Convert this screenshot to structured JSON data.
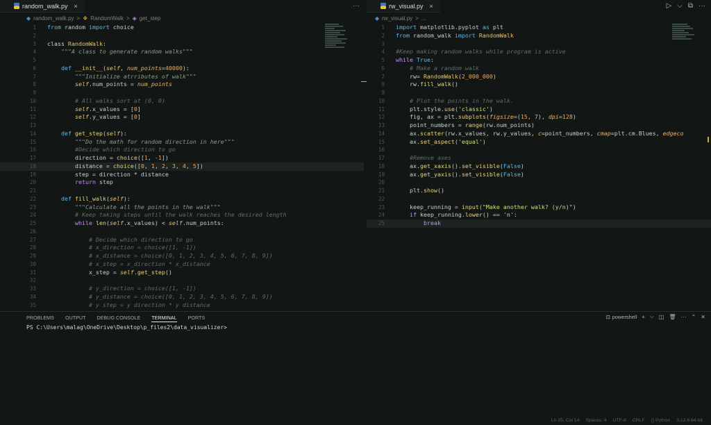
{
  "left_tab": {
    "name": "random_walk.py",
    "close": "×"
  },
  "right_tab": {
    "name": "rw_visual.py",
    "close": "×"
  },
  "more": "···",
  "run_actions": [
    "▷",
    "⌵",
    "⧉",
    "···"
  ],
  "left_breadcrumb": [
    "random_walk.py",
    ">",
    "RandomWalk",
    ">",
    "get_step"
  ],
  "right_breadcrumb": [
    "rw_visual.py",
    ">",
    "..."
  ],
  "panel": {
    "tabs": [
      "PROBLEMS",
      "OUTPUT",
      "DEBUG CONSOLE",
      "TERMINAL",
      "PORTS"
    ],
    "active_tab": "TERMINAL",
    "shell": "powershell",
    "actions": [
      "+",
      "⌵",
      "◫",
      "🗑",
      "···",
      "⌃",
      "✕"
    ],
    "terminal_text": "PS C:\\Users\\malag\\OneDrive\\Desktop\\p_files2\\data_visualizer>"
  },
  "status": [
    "Ln 25, Col 14",
    "Spaces: 4",
    "UTF-8",
    "CRLF",
    "{} Python",
    "3.12.6 64-bit"
  ],
  "left_code": [
    {
      "n": 1,
      "t": [
        [
          "kw2",
          "from"
        ],
        [
          "pun",
          " random "
        ],
        [
          "kw2",
          "import"
        ],
        [
          "pun",
          " choice"
        ]
      ]
    },
    {
      "n": 2,
      "t": []
    },
    {
      "n": 3,
      "t": [
        [
          "pun",
          "class "
        ],
        [
          "cls",
          "RandomWalk"
        ],
        [
          "pun",
          ":"
        ]
      ]
    },
    {
      "n": 4,
      "t": [
        [
          "pun",
          "    "
        ],
        [
          "doc",
          "\"\"\"A class to generate random walks\"\"\""
        ]
      ]
    },
    {
      "n": 5,
      "t": []
    },
    {
      "n": 6,
      "t": [
        [
          "pun",
          "    "
        ],
        [
          "kw2",
          "def"
        ],
        [
          "fn",
          " __init__"
        ],
        [
          "pun",
          "("
        ],
        [
          "selfc",
          "self"
        ],
        [
          "pun",
          ", "
        ],
        [
          "par",
          "num_points"
        ],
        [
          "pun",
          "="
        ],
        [
          "num",
          "40000"
        ],
        [
          "pun",
          "):"
        ]
      ]
    },
    {
      "n": 7,
      "t": [
        [
          "pun",
          "        "
        ],
        [
          "doc",
          "\"\"\"Initialize atrributes of walk\"\"\""
        ]
      ]
    },
    {
      "n": 8,
      "t": [
        [
          "pun",
          "        "
        ],
        [
          "selfc",
          "self"
        ],
        [
          "pun",
          ".num_points = "
        ],
        [
          "par",
          "num_points"
        ]
      ]
    },
    {
      "n": 9,
      "t": []
    },
    {
      "n": 10,
      "t": [
        [
          "pun",
          "        "
        ],
        [
          "cmt",
          "# All walks sort at (0, 0)"
        ]
      ]
    },
    {
      "n": 11,
      "t": [
        [
          "pun",
          "        "
        ],
        [
          "selfc",
          "self"
        ],
        [
          "pun",
          ".x_values = ["
        ],
        [
          "num",
          "0"
        ],
        [
          "pun",
          "]"
        ]
      ]
    },
    {
      "n": 12,
      "t": [
        [
          "pun",
          "        "
        ],
        [
          "selfc",
          "self"
        ],
        [
          "pun",
          ".y_values = ["
        ],
        [
          "num",
          "0"
        ],
        [
          "pun",
          "]"
        ]
      ]
    },
    {
      "n": 13,
      "t": []
    },
    {
      "n": 14,
      "t": [
        [
          "pun",
          "    "
        ],
        [
          "kw2",
          "def"
        ],
        [
          "fn",
          " get_step"
        ],
        [
          "pun",
          "("
        ],
        [
          "selfc",
          "self"
        ],
        [
          "pun",
          "):"
        ]
      ]
    },
    {
      "n": 15,
      "t": [
        [
          "pun",
          "        "
        ],
        [
          "doc",
          "\"\"\"Do the math for random direction in here\"\"\""
        ]
      ]
    },
    {
      "n": 16,
      "t": [
        [
          "pun",
          "        "
        ],
        [
          "cmt",
          "#Decide which direction to go"
        ]
      ]
    },
    {
      "n": 17,
      "t": [
        [
          "pun",
          "        direction = "
        ],
        [
          "fn",
          "choice"
        ],
        [
          "pun",
          "(["
        ],
        [
          "num",
          "1"
        ],
        [
          "pun",
          ", "
        ],
        [
          "num",
          "-1"
        ],
        [
          "pun",
          "])"
        ]
      ]
    },
    {
      "n": 18,
      "t": [
        [
          "pun",
          "        distance = "
        ],
        [
          "fn",
          "choice"
        ],
        [
          "pun",
          "(["
        ],
        [
          "num",
          "0"
        ],
        [
          "pun",
          ", "
        ],
        [
          "num",
          "1"
        ],
        [
          "pun",
          ", "
        ],
        [
          "num",
          "2"
        ],
        [
          "pun",
          ", "
        ],
        [
          "num",
          "3"
        ],
        [
          "pun",
          ", "
        ],
        [
          "num",
          "4"
        ],
        [
          "pun",
          ", "
        ],
        [
          "num",
          "5"
        ],
        [
          "pun",
          "])"
        ]
      ],
      "cur": true
    },
    {
      "n": 19,
      "t": [
        [
          "pun",
          "        step = direction * distance"
        ]
      ]
    },
    {
      "n": 20,
      "t": [
        [
          "pun",
          "        "
        ],
        [
          "kw",
          "return"
        ],
        [
          "pun",
          " step"
        ]
      ]
    },
    {
      "n": 21,
      "t": []
    },
    {
      "n": 22,
      "t": [
        [
          "pun",
          "    "
        ],
        [
          "kw2",
          "def"
        ],
        [
          "fn",
          " fill_walk"
        ],
        [
          "pun",
          "("
        ],
        [
          "selfc",
          "self"
        ],
        [
          "pun",
          "):"
        ]
      ]
    },
    {
      "n": 23,
      "t": [
        [
          "pun",
          "        "
        ],
        [
          "doc",
          "\"\"\"Calculate all the points in the walk\"\"\""
        ]
      ]
    },
    {
      "n": 24,
      "t": [
        [
          "pun",
          "        "
        ],
        [
          "cmt",
          "# Keep taking steps until the walk reaches the desired length"
        ]
      ]
    },
    {
      "n": 25,
      "t": [
        [
          "pun",
          "        "
        ],
        [
          "kw",
          "while"
        ],
        [
          "pun",
          " "
        ],
        [
          "fn",
          "len"
        ],
        [
          "pun",
          "("
        ],
        [
          "selfc",
          "self"
        ],
        [
          "pun",
          ".x_values) < "
        ],
        [
          "selfc",
          "self"
        ],
        [
          "pun",
          ".num_points:"
        ]
      ]
    },
    {
      "n": 26,
      "t": []
    },
    {
      "n": 27,
      "t": [
        [
          "pun",
          "            "
        ],
        [
          "cmt",
          "# Decide which direction to go"
        ]
      ]
    },
    {
      "n": 28,
      "t": [
        [
          "pun",
          "            "
        ],
        [
          "cmt",
          "# x_direction = choice([1, -1])"
        ]
      ]
    },
    {
      "n": 29,
      "t": [
        [
          "pun",
          "            "
        ],
        [
          "cmt",
          "# x_distance = choice([0, 1, 2, 3, 4, 5, 6, 7, 8, 9])"
        ]
      ]
    },
    {
      "n": 30,
      "t": [
        [
          "pun",
          "            "
        ],
        [
          "cmt",
          "# x_step = x_direction * x_distance"
        ]
      ]
    },
    {
      "n": 31,
      "t": [
        [
          "pun",
          "            x_step = "
        ],
        [
          "selfc",
          "self"
        ],
        [
          "pun",
          "."
        ],
        [
          "fn",
          "get_step"
        ],
        [
          "pun",
          "()"
        ]
      ]
    },
    {
      "n": 32,
      "t": []
    },
    {
      "n": 33,
      "t": [
        [
          "pun",
          "            "
        ],
        [
          "cmt",
          "# y_direction = choice([1, -1])"
        ]
      ]
    },
    {
      "n": 34,
      "t": [
        [
          "pun",
          "            "
        ],
        [
          "cmt",
          "# y_distance = choice([0, 1, 2, 3, 4, 5, 6, 7, 8, 9])"
        ]
      ]
    },
    {
      "n": 35,
      "t": [
        [
          "pun",
          "            "
        ],
        [
          "cmt",
          "# y step = y direction * y distance"
        ]
      ]
    }
  ],
  "right_code": [
    {
      "n": 1,
      "t": [
        [
          "kw2",
          "import"
        ],
        [
          "pun",
          " matplotlib.pyplot "
        ],
        [
          "kw2",
          "as"
        ],
        [
          "pun",
          " plt"
        ]
      ]
    },
    {
      "n": 2,
      "t": [
        [
          "kw2",
          "from"
        ],
        [
          "pun",
          " random_walk "
        ],
        [
          "kw2",
          "import"
        ],
        [
          "pun",
          " "
        ],
        [
          "cls",
          "RandomWalk"
        ]
      ]
    },
    {
      "n": 3,
      "t": []
    },
    {
      "n": 4,
      "t": [
        [
          "cmt",
          "#Keep making random walks while program is active"
        ]
      ]
    },
    {
      "n": 5,
      "t": [
        [
          "kw",
          "while"
        ],
        [
          "pun",
          " "
        ],
        [
          "kw2",
          "True"
        ],
        [
          "pun",
          ":"
        ]
      ]
    },
    {
      "n": 6,
      "t": [
        [
          "pun",
          "    "
        ],
        [
          "cmt",
          "# Make a random walk"
        ]
      ]
    },
    {
      "n": 7,
      "t": [
        [
          "pun",
          "    rw= "
        ],
        [
          "cls",
          "RandomWalk"
        ],
        [
          "pun",
          "("
        ],
        [
          "num",
          "2_000_000"
        ],
        [
          "pun",
          ")"
        ]
      ]
    },
    {
      "n": 8,
      "t": [
        [
          "pun",
          "    rw."
        ],
        [
          "fn",
          "fill_walk"
        ],
        [
          "pun",
          "()"
        ]
      ]
    },
    {
      "n": 9,
      "t": []
    },
    {
      "n": 10,
      "t": [
        [
          "pun",
          "    "
        ],
        [
          "cmt",
          "# Plot the points in the walk."
        ]
      ]
    },
    {
      "n": 11,
      "t": [
        [
          "pun",
          "    plt.style."
        ],
        [
          "fn",
          "use"
        ],
        [
          "pun",
          "("
        ],
        [
          "str",
          "'classic'"
        ],
        [
          "pun",
          ")"
        ]
      ]
    },
    {
      "n": 12,
      "t": [
        [
          "pun",
          "    fig, ax = plt."
        ],
        [
          "fn",
          "subplots"
        ],
        [
          "pun",
          "("
        ],
        [
          "par",
          "figsize"
        ],
        [
          "pun",
          "=("
        ],
        [
          "num",
          "15"
        ],
        [
          "pun",
          ", "
        ],
        [
          "num",
          "7"
        ],
        [
          "pun",
          "), "
        ],
        [
          "par",
          "dpi"
        ],
        [
          "pun",
          "="
        ],
        [
          "num",
          "128"
        ],
        [
          "pun",
          ")"
        ]
      ]
    },
    {
      "n": 13,
      "t": [
        [
          "pun",
          "    point_numbers = "
        ],
        [
          "fn",
          "range"
        ],
        [
          "pun",
          "(rw.num_points)"
        ]
      ]
    },
    {
      "n": 14,
      "t": [
        [
          "pun",
          "    ax."
        ],
        [
          "fn",
          "scatter"
        ],
        [
          "pun",
          "(rw.x_values, rw.y_values, "
        ],
        [
          "par",
          "c"
        ],
        [
          "pun",
          "=point_numbers, "
        ],
        [
          "par",
          "cmap"
        ],
        [
          "pun",
          "=plt.cm.Blues, "
        ],
        [
          "par",
          "edgeco"
        ]
      ]
    },
    {
      "n": 15,
      "t": [
        [
          "pun",
          "    ax."
        ],
        [
          "fn",
          "set_aspect"
        ],
        [
          "pun",
          "("
        ],
        [
          "str",
          "'equal'"
        ],
        [
          "pun",
          ")"
        ]
      ]
    },
    {
      "n": 16,
      "t": []
    },
    {
      "n": 17,
      "t": [
        [
          "pun",
          "    "
        ],
        [
          "cmt",
          "#Remove axes"
        ]
      ]
    },
    {
      "n": 18,
      "t": [
        [
          "pun",
          "    ax."
        ],
        [
          "fn",
          "get_xaxis"
        ],
        [
          "pun",
          "()."
        ],
        [
          "fn",
          "set_visible"
        ],
        [
          "pun",
          "("
        ],
        [
          "kw2",
          "False"
        ],
        [
          "pun",
          ")"
        ]
      ]
    },
    {
      "n": 19,
      "t": [
        [
          "pun",
          "    ax."
        ],
        [
          "fn",
          "get_yaxis"
        ],
        [
          "pun",
          "()."
        ],
        [
          "fn",
          "set_visible"
        ],
        [
          "pun",
          "("
        ],
        [
          "kw2",
          "False"
        ],
        [
          "pun",
          ")"
        ]
      ]
    },
    {
      "n": 20,
      "t": []
    },
    {
      "n": 21,
      "t": [
        [
          "pun",
          "    plt."
        ],
        [
          "fn",
          "show"
        ],
        [
          "pun",
          "()"
        ]
      ]
    },
    {
      "n": 22,
      "t": []
    },
    {
      "n": 23,
      "t": [
        [
          "pun",
          "    keep_running = "
        ],
        [
          "fn",
          "input"
        ],
        [
          "pun",
          "("
        ],
        [
          "str",
          "\"Make another walk? (y/n)\""
        ],
        [
          "pun",
          ")"
        ]
      ]
    },
    {
      "n": 24,
      "t": [
        [
          "pun",
          "    "
        ],
        [
          "kw",
          "if"
        ],
        [
          "pun",
          " keep_running."
        ],
        [
          "fn",
          "lower"
        ],
        [
          "pun",
          "() == "
        ],
        [
          "str",
          "'n'"
        ],
        [
          "pun",
          ":"
        ]
      ]
    },
    {
      "n": 25,
      "t": [
        [
          "pun",
          "        "
        ],
        [
          "kw",
          "break"
        ]
      ],
      "cur": true
    }
  ]
}
